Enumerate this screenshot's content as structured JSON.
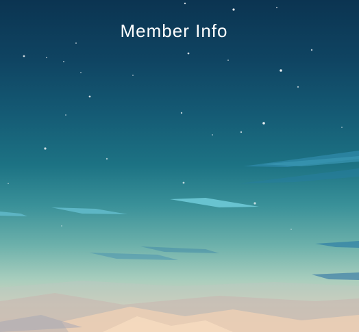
{
  "header": {
    "title": "Member Info"
  },
  "colors": {
    "sky_top": "#0b3451",
    "sky_mid": "#1d7384",
    "horizon": "#e9c9b3",
    "title_text": "#ffffff"
  }
}
